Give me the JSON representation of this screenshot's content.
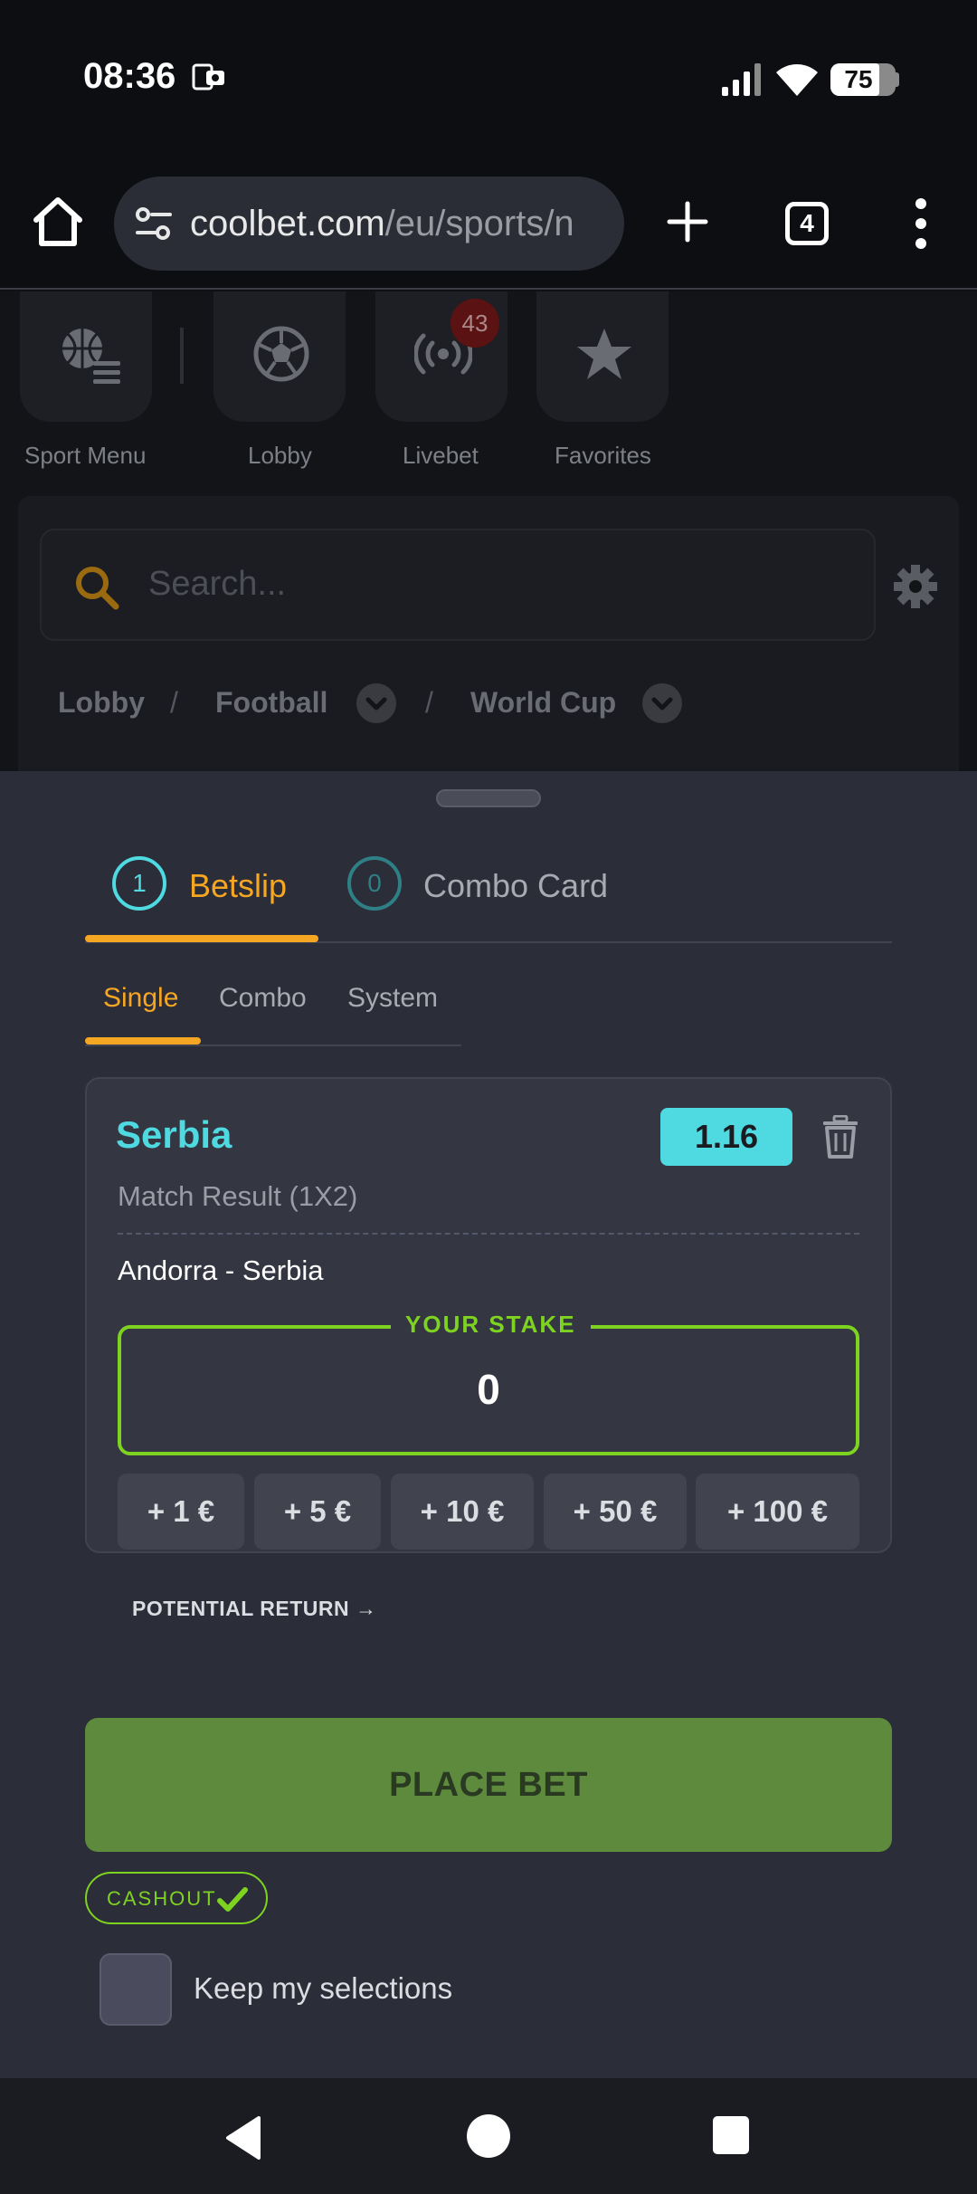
{
  "status_bar": {
    "time": "08:36",
    "battery": "75",
    "battery_level": 0.75,
    "icons": [
      "notification-icon",
      "signal-icon",
      "wifi-icon",
      "battery-icon"
    ]
  },
  "browser": {
    "url_host": "coolbet.com",
    "url_path": "/eu/sports/n",
    "tab_count": "4",
    "icons": [
      "home-icon",
      "site-settings-icon",
      "plus-icon",
      "menu-dots-icon"
    ]
  },
  "quick_nav": {
    "items": [
      {
        "label": "Sport Menu",
        "icon": "sport-menu-icon"
      },
      {
        "label": "Lobby",
        "icon": "football-icon"
      },
      {
        "label": "Livebet",
        "icon": "live-broadcast-icon",
        "badge": "43"
      },
      {
        "label": "Favorites",
        "icon": "star-icon"
      }
    ]
  },
  "search": {
    "placeholder": "Search..."
  },
  "breadcrumb": {
    "items": [
      "Lobby",
      "Football",
      "World Cup"
    ],
    "separator": "/"
  },
  "betslip": {
    "tabs": [
      {
        "count": "1",
        "label": "Betslip",
        "active": true
      },
      {
        "count": "0",
        "label": "Combo Card",
        "active": false
      }
    ],
    "sub_tabs": [
      {
        "label": "Single",
        "active": true
      },
      {
        "label": "Combo",
        "active": false
      },
      {
        "label": "System",
        "active": false
      }
    ],
    "selection": {
      "name": "Serbia",
      "market": "Match Result (1X2)",
      "odds": "1.16",
      "event": "Andorra - Serbia"
    },
    "stake": {
      "label": "YOUR STAKE",
      "value": "0"
    },
    "quick_stakes": [
      "+ 1 €",
      "+ 5 €",
      "+ 10 €",
      "+ 50 €",
      "+ 100 €"
    ],
    "potential_return": "POTENTIAL RETURN →",
    "place_bet": "PLACE BET",
    "cashout": "CASHOUT",
    "keep_selections": "Keep my selections"
  },
  "colors": {
    "accent_orange": "#f5a623",
    "accent_cyan": "#4fd9e0",
    "accent_green": "#7ed321",
    "place_bet_bg": "#5d8a3c"
  }
}
